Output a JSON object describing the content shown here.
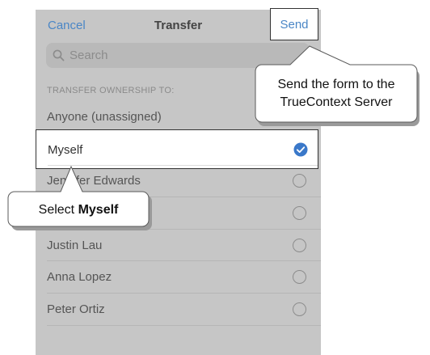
{
  "navbar": {
    "cancel_label": "Cancel",
    "title": "Transfer",
    "send_label": "Send"
  },
  "search": {
    "placeholder": "Search",
    "icon": "search-icon"
  },
  "section_header": "TRANSFER OWNERSHIP TO:",
  "options": [
    {
      "label": "Anyone (unassigned)",
      "selected": false
    },
    {
      "label": "Myself",
      "selected": true
    },
    {
      "label": "Jennifer Edwards",
      "selected": false
    },
    {
      "label": "",
      "selected": false
    },
    {
      "label": "Justin Lau",
      "selected": false
    },
    {
      "label": "Anna Lopez",
      "selected": false
    },
    {
      "label": "Peter Ortiz",
      "selected": false
    }
  ],
  "callouts": {
    "send": {
      "line1": "Send the form to the",
      "line2": "TrueContext Server"
    },
    "select": {
      "prefix": "Select ",
      "bold": "Myself"
    }
  },
  "colors": {
    "accent": "#4a86c6",
    "check_fill": "#3a78c9",
    "screen_dim": "#c6c6c6"
  }
}
